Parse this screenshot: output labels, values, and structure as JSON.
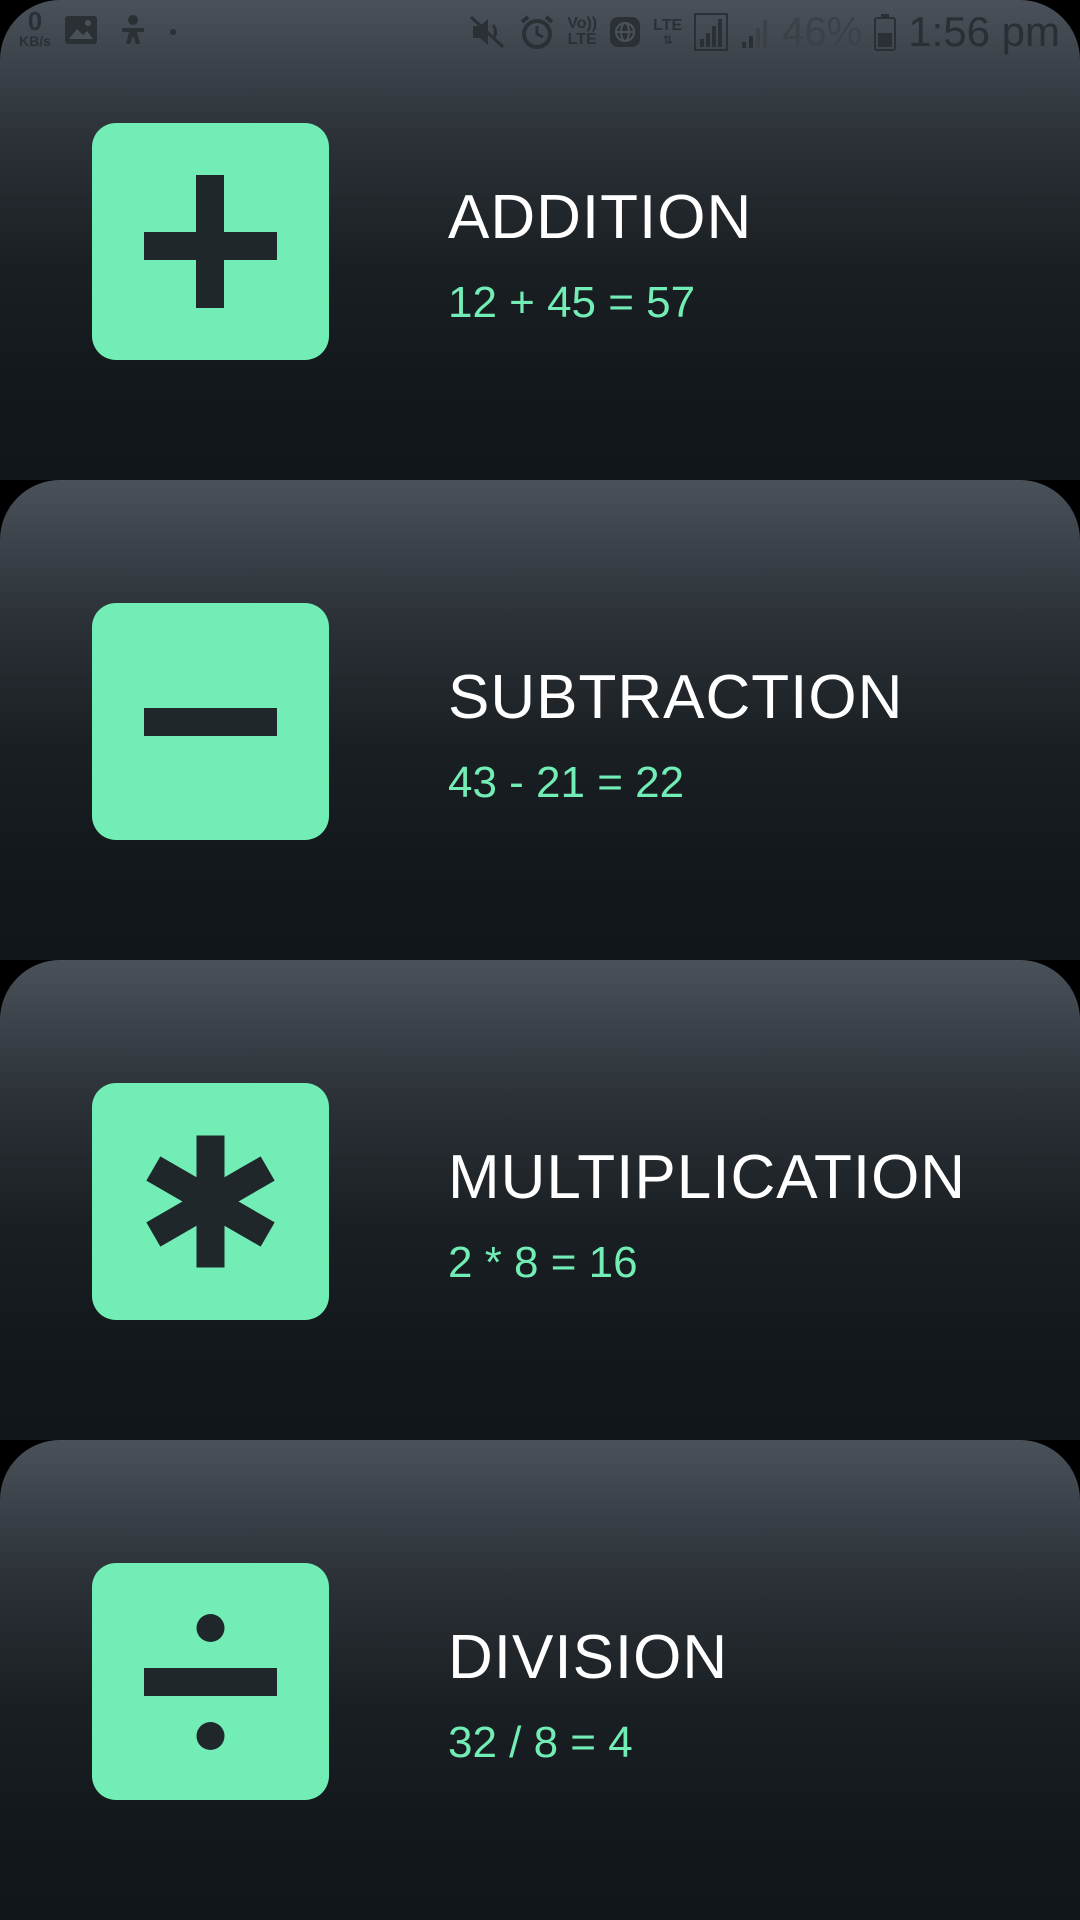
{
  "status_bar": {
    "net_speed_value": "0",
    "net_speed_unit": "KB/s",
    "volte_label_top": "Vo))",
    "volte_label_bottom": "LTE",
    "lte_label": "LTE",
    "battery_percent": "46%",
    "time": "1:56 pm",
    "icons": [
      "gallery-icon",
      "accessibility-icon",
      "dot-icon",
      "mute-icon",
      "alarm-icon",
      "globe-icon",
      "signal-icon",
      "signal-weak-icon",
      "battery-icon"
    ]
  },
  "operations": [
    {
      "title": "ADDITION",
      "example": "12 + 45 = 57",
      "icon": "plus-icon"
    },
    {
      "title": "SUBTRACTION",
      "example": "43 - 21 = 22",
      "icon": "minus-icon"
    },
    {
      "title": "MULTIPLICATION",
      "example": "2 * 8 = 16",
      "icon": "asterisk-icon"
    },
    {
      "title": "DIVISION",
      "example": "32 / 8 = 4",
      "icon": "divide-icon"
    }
  ],
  "colors": {
    "accent": "#72edb5",
    "icon_glyph": "#1f272b",
    "card_top": "#4a515a",
    "card_bottom": "#101619",
    "title_text": "#ffffff"
  }
}
